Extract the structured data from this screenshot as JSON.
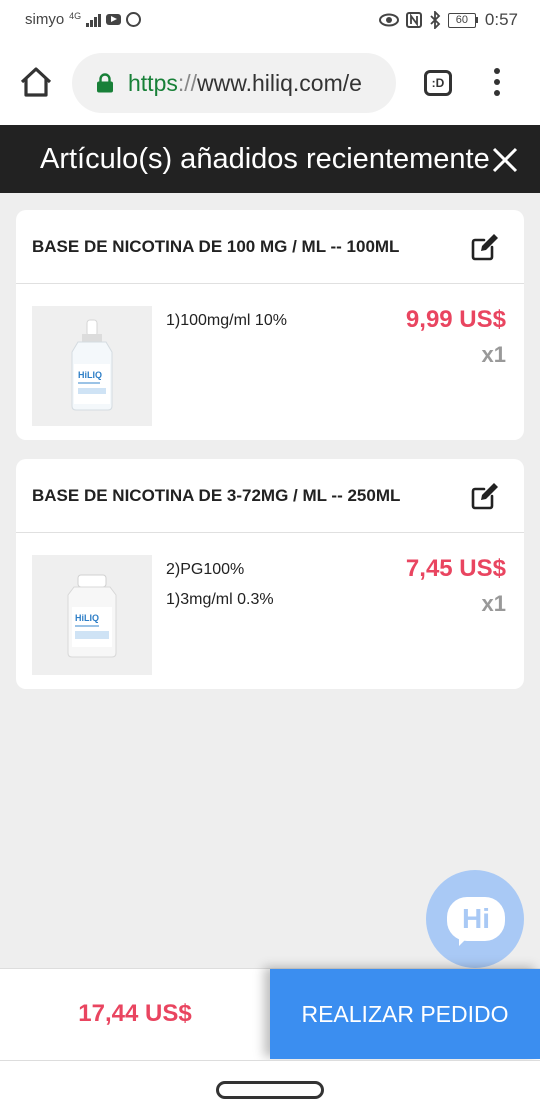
{
  "status_bar": {
    "carrier": "simyo",
    "network": "4G",
    "battery": "60",
    "time": "0:57"
  },
  "browser": {
    "url_scheme": "https",
    "url_separator": "://",
    "url_host": "www.hiliq.com/e",
    "tabs_label": ":D"
  },
  "page": {
    "title": "Artículo(s) añadidos recientemente"
  },
  "items": [
    {
      "name": "BASE DE NICOTINA DE 100 MG / ML -- 100ML",
      "options": [
        "1)100mg/ml 10%"
      ],
      "price": "9,99 US$",
      "qty": "x1",
      "thumb_brand": "HiLIQ"
    },
    {
      "name": "BASE DE NICOTINA DE 3-72MG / ML -- 250ML",
      "options": [
        "2)PG100%",
        "1)3mg/ml 0.3%"
      ],
      "price": "7,45 US$",
      "qty": "x1",
      "thumb_brand": "HiLIQ"
    }
  ],
  "chat": {
    "label": "Hi"
  },
  "footer": {
    "total": "17,44 US$",
    "checkout_label": "REALIZAR PEDIDO"
  },
  "colors": {
    "price": "#e94560",
    "checkout": "#3b8ef0",
    "header": "#222222",
    "chat": "#a9c9f5"
  }
}
